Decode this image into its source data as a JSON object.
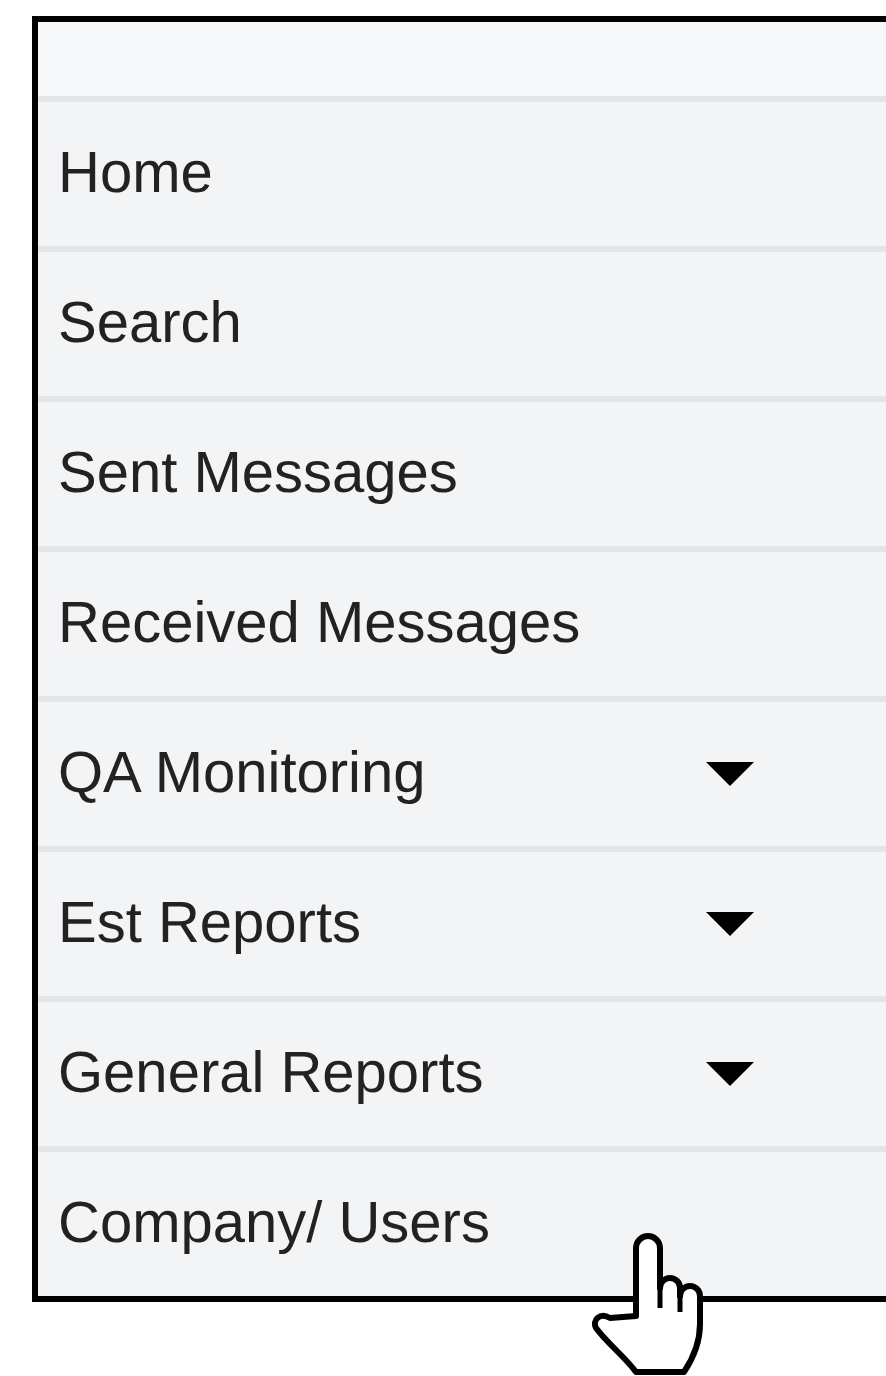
{
  "menu": {
    "items": [
      {
        "label": "Home",
        "has_dropdown": false
      },
      {
        "label": "Search",
        "has_dropdown": false
      },
      {
        "label": "Sent Messages",
        "has_dropdown": false
      },
      {
        "label": "Received Messages",
        "has_dropdown": false
      },
      {
        "label": "QA Monitoring",
        "has_dropdown": true
      },
      {
        "label": "Est Reports",
        "has_dropdown": true
      },
      {
        "label": "General Reports",
        "has_dropdown": true
      },
      {
        "label": "Company/ Users",
        "has_dropdown": false
      }
    ]
  }
}
